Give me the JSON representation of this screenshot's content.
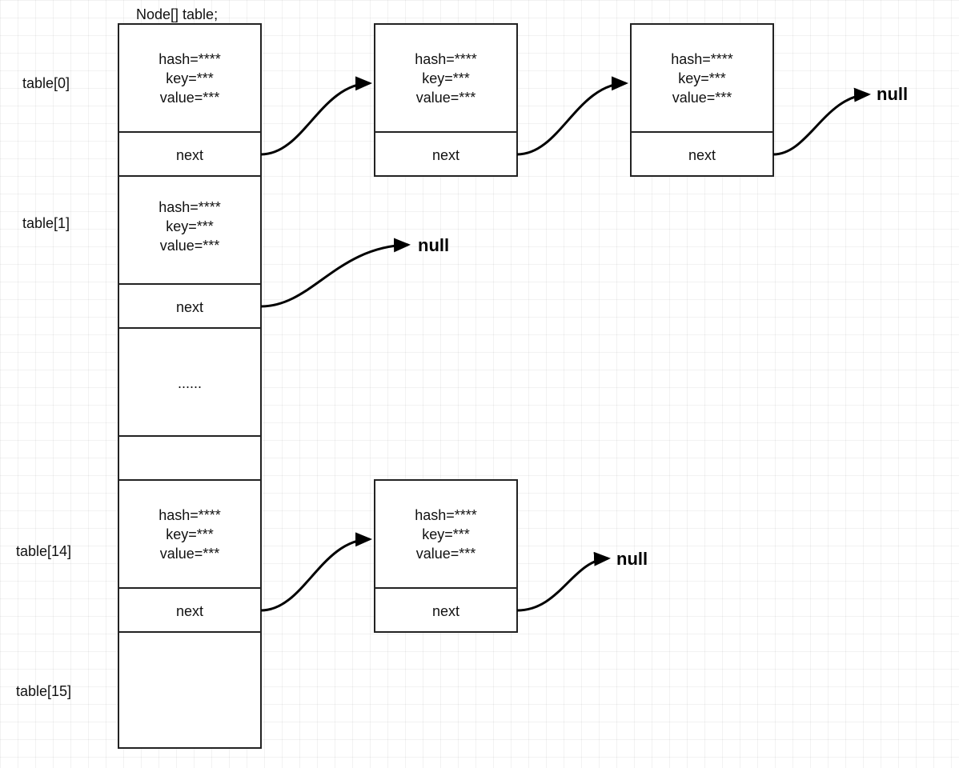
{
  "title": "Node[] table;",
  "labels": {
    "row0": "table[0]",
    "row1": "table[1]",
    "row14": "table[14]",
    "row15": "table[15]",
    "ellipsis": "......"
  },
  "fields": {
    "hash": "hash=****",
    "key": "key=***",
    "value": "value=***",
    "next": "next"
  },
  "nulls": {
    "n0": "null",
    "n1": "null",
    "n14": "null"
  }
}
